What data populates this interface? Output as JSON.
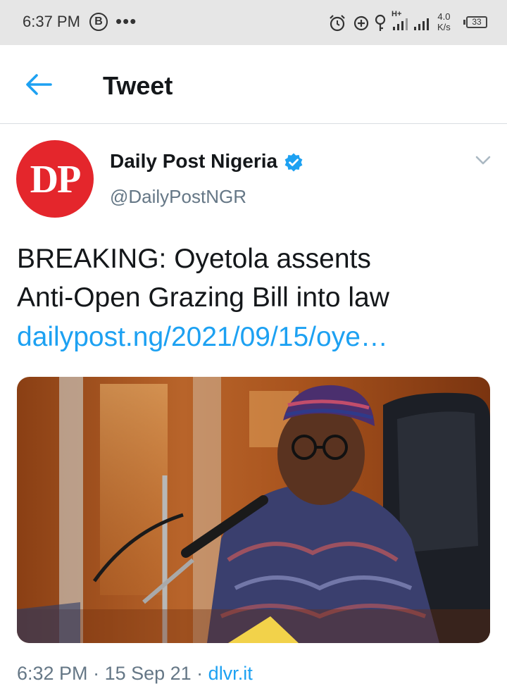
{
  "status_bar": {
    "time": "6:37 PM",
    "b_badge": "B",
    "more": "•••",
    "network_type": "H+",
    "speed_value": "4.0",
    "speed_unit": "K/s",
    "battery": "33"
  },
  "header": {
    "title": "Tweet"
  },
  "tweet": {
    "avatar_text": "DP",
    "display_name": "Daily Post Nigeria",
    "handle": "@DailyPostNGR",
    "text_line1": "BREAKING: Oyetola assents",
    "text_line2": "Anti-Open Grazing Bill into law",
    "link": "dailypost.ng/2021/09/15/oye…",
    "time": "6:32 PM",
    "separator": " · ",
    "date": "15 Sep 21",
    "source": "dlvr.it"
  },
  "icons": {
    "back": "arrow-left-icon",
    "verified": "verified-badge-icon",
    "more": "chevron-down-icon"
  },
  "colors": {
    "accent": "#1da1f2",
    "avatar_bg": "#e4262c",
    "secondary_text": "#657786"
  }
}
